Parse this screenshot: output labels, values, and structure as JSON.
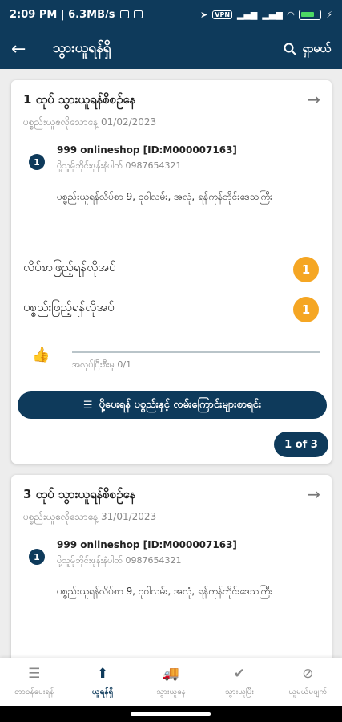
{
  "status_bar": {
    "time_speed": "2:09 PM | 6.3MB/s",
    "vpn": "VPN",
    "battery_bolt": "⚡"
  },
  "app_bar": {
    "back_icon": "arrow-back-icon",
    "title": "သွားယူရန်ရှိ",
    "search_label": "ရှာမယ်"
  },
  "cards": [
    {
      "title": "1 ထုပ် သွားယူရန်စိစဉ်နေ",
      "date_line": "ပစ္စည်းယူဧလိုသောနေ့ 01/02/2023",
      "step_number": "1",
      "shop": "999 onlineshop [ID:M000007163]",
      "phone_line": "ပို့သူမိုဘိုင်းဖုန်းနံပါတ် 0987654321",
      "address": "ပစ္စည်းယူရန်လိပ်စာ 9, ငုဝါလမ်း, အလုံ, ရန်ကုန်တိုင်းဒေသကြီး",
      "rows": [
        {
          "label": "လိပ်စာဖြည့်ရန်လိုအပ်",
          "count": "1"
        },
        {
          "label": "ပစ္စည်းဖြည့်ရန်လိုအပ်",
          "count": "1"
        }
      ],
      "progress": {
        "text": "အလုပ်ပြီးစီးမှု 0/1",
        "fraction": 0
      },
      "list_button": "ပို့ပေးရန် ပစ္စည်းနှင့် လမ်းကြောင်းများစာရင်း",
      "pager": "1 of 3"
    },
    {
      "title": "3 ထုပ် သွားယူရန်စိစဉ်နေ",
      "date_line": "ပစ္စည်းယူဧလိုသောနေ့ 31/01/2023",
      "step_number": "1",
      "shop": "999 onlineshop [ID:M000007163]",
      "phone_line": "ပို့သူမိုဘိုင်းဖုန်းနံပါတ် 0987654321",
      "address": "ပစ္စည်းယူရန်လိပ်စာ 9, ငုဝါလမ်း, အလုံ, ရန်ကုန်တိုင်းဒေသကြီး"
    }
  ],
  "bottom_nav": [
    {
      "label": "တာဝန်ပေးရန်",
      "icon": "list-icon",
      "glyph": "☰"
    },
    {
      "label": "ယူရန်ရှိ",
      "icon": "upload-icon",
      "glyph": "⬆"
    },
    {
      "label": "သွားယူနေ",
      "icon": "truck-icon",
      "glyph": "🚚"
    },
    {
      "label": "သွားယူပြီး",
      "icon": "check-icon",
      "glyph": "✔"
    },
    {
      "label": "ယူမယ်မဖျက်",
      "icon": "cancel-truck-icon",
      "glyph": "⊘"
    }
  ],
  "colors": {
    "primary": "#0e3a5b",
    "badge": "#f5a623",
    "background": "#ededed"
  }
}
